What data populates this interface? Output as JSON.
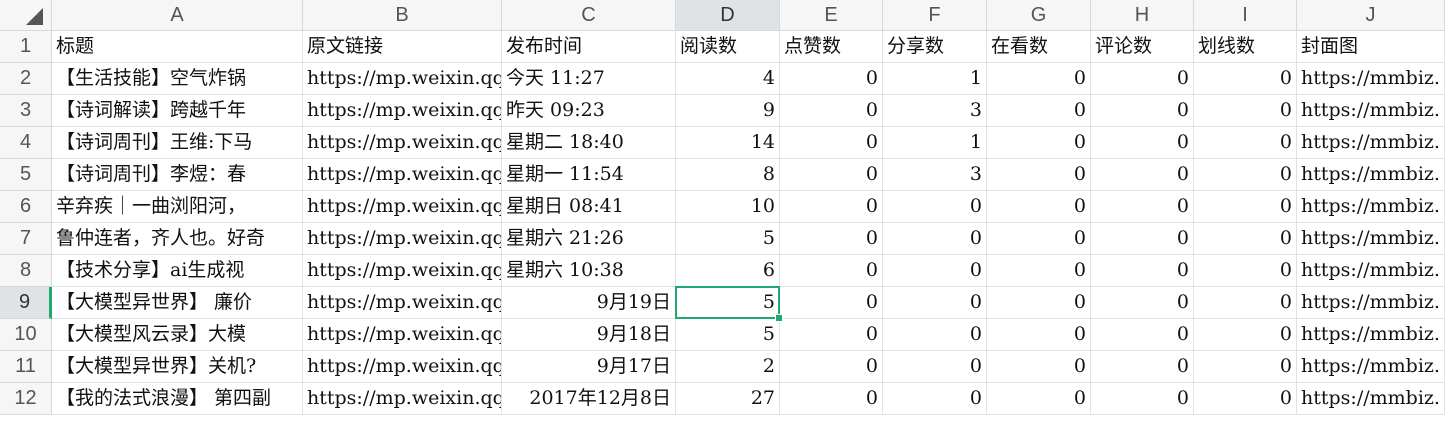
{
  "sheet": {
    "columns": [
      "A",
      "B",
      "C",
      "D",
      "E",
      "F",
      "G",
      "H",
      "I",
      "J"
    ],
    "rows": [
      "1",
      "2",
      "3",
      "4",
      "5",
      "6",
      "7",
      "8",
      "9",
      "10",
      "11",
      "12"
    ],
    "headers": [
      "标题",
      "原文链接",
      "发布时间",
      "阅读数",
      "点赞数",
      "分享数",
      "在看数",
      "评论数",
      "划线数",
      "封面图"
    ],
    "data": [
      [
        "【生活技能】空气炸锅",
        "https://mp.weixin.qq",
        "今天 11:27",
        "4",
        "0",
        "1",
        "0",
        "0",
        "0",
        "https://mmbiz."
      ],
      [
        "【诗词解读】跨越千年",
        "https://mp.weixin.qq",
        "昨天 09:23",
        "9",
        "0",
        "3",
        "0",
        "0",
        "0",
        "https://mmbiz."
      ],
      [
        "【诗词周刊】王维:下马",
        "https://mp.weixin.qq",
        "星期二 18:40",
        "14",
        "0",
        "1",
        "0",
        "0",
        "0",
        "https://mmbiz."
      ],
      [
        "【诗词周刊】李煜：春",
        "https://mp.weixin.qq",
        "星期一 11:54",
        "8",
        "0",
        "3",
        "0",
        "0",
        "0",
        "https://mmbiz."
      ],
      [
        "辛弃疾｜一曲浏阳河，",
        "https://mp.weixin.qq",
        "星期日 08:41",
        "10",
        "0",
        "0",
        "0",
        "0",
        "0",
        "https://mmbiz."
      ],
      [
        "鲁仲连者，齐人也。好奇",
        "https://mp.weixin.qq",
        "星期六 21:26",
        "5",
        "0",
        "0",
        "0",
        "0",
        "0",
        "https://mmbiz."
      ],
      [
        "【技术分享】ai生成视",
        "https://mp.weixin.qq",
        "星期六 10:38",
        "6",
        "0",
        "0",
        "0",
        "0",
        "0",
        "https://mmbiz."
      ],
      [
        "【大模型异世界】 廉价",
        "https://mp.weixin.qq",
        "9月19日",
        "5",
        "0",
        "0",
        "0",
        "0",
        "0",
        "https://mmbiz."
      ],
      [
        "【大模型风云录】大模",
        "https://mp.weixin.qq",
        "9月18日",
        "5",
        "0",
        "0",
        "0",
        "0",
        "0",
        "https://mmbiz."
      ],
      [
        "【大模型异世界】关机?",
        "https://mp.weixin.qq",
        "9月17日",
        "2",
        "0",
        "0",
        "0",
        "0",
        "0",
        "https://mmbiz."
      ],
      [
        "【我的法式浪漫】 第四副",
        "https://mp.weixin.qq",
        "2017年12月8日",
        "27",
        "0",
        "0",
        "0",
        "0",
        "0",
        "https://mmbiz."
      ]
    ],
    "selected_cell": "D9",
    "colors": {
      "selection": "#1fa971",
      "header_bg": "#f6f6f6",
      "header_selected_bg": "#e0e3e6",
      "grid": "#dde3ea"
    }
  }
}
